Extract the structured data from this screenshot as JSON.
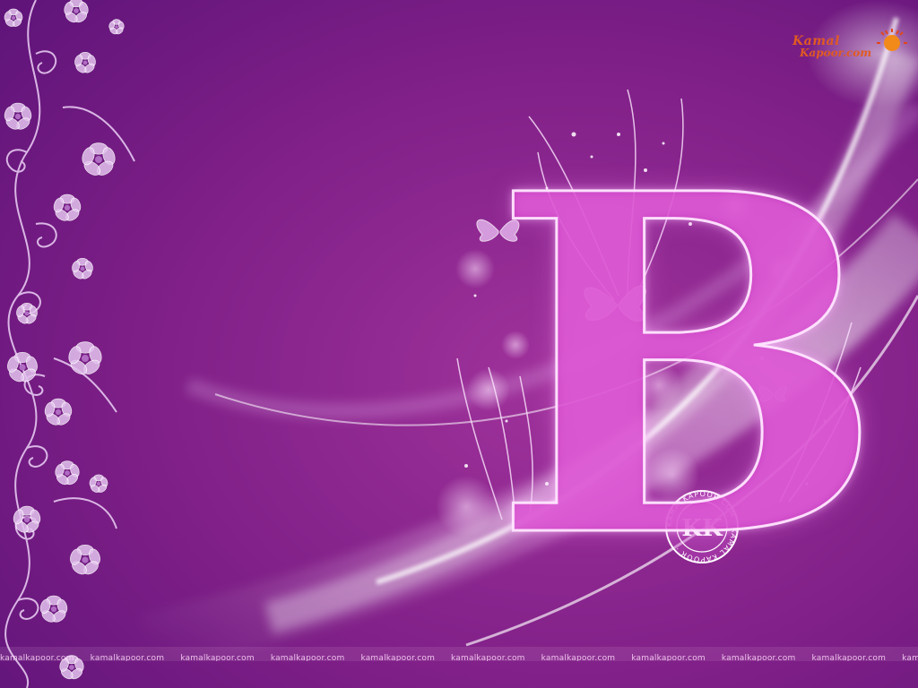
{
  "image": {
    "letter": "B",
    "background_color": "#7a1f86",
    "accent_colors": [
      "#5e137a",
      "#9a2a92",
      "#d45cd0",
      "#f4d9f4"
    ]
  },
  "brand": {
    "logo_line1": "Kamal",
    "logo_line2": "Kapoor.com",
    "sun_icon": "sun-icon"
  },
  "seal": {
    "monogram": "KK",
    "ring_text": "KAMALKAPOOR.COM · KAMAL KAPOOR ·"
  },
  "footer": {
    "watermark_text": "kamalkapoor.com",
    "repeat": [
      "kamalkapoor.com",
      "kamalkapoor.com",
      "kamalkapoor.com",
      "kamalkapoor.com",
      "kamalkapoor.com",
      "kamalkapoor.com",
      "kamalkapoor.com",
      "kamalkapoor.com",
      "kamalkapoor.com",
      "kamalkapoor.com",
      "kamalkapoor.com"
    ]
  }
}
